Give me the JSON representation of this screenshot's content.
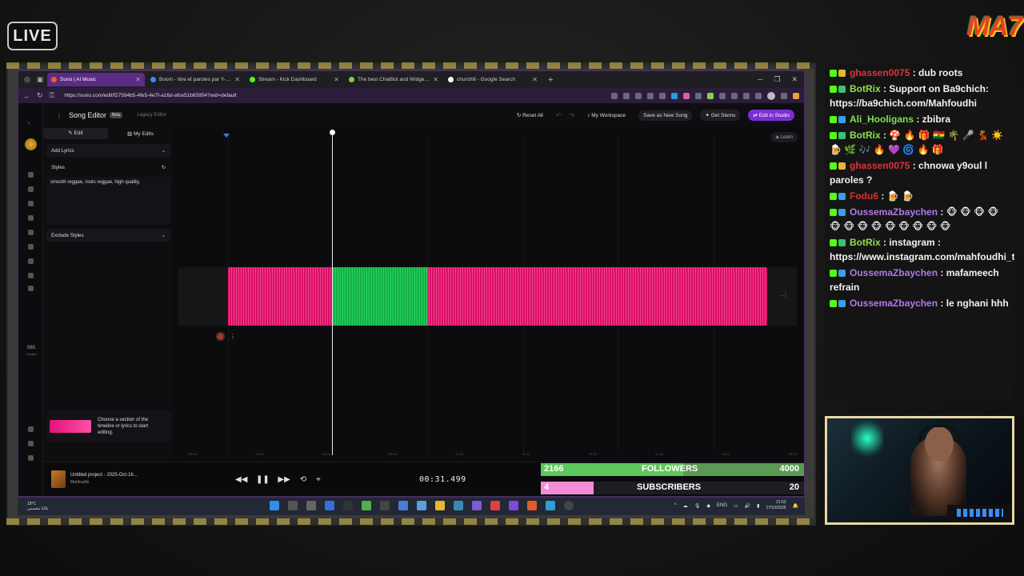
{
  "overlay": {
    "live_label": "LIVE",
    "logo_text": "MA7"
  },
  "browser": {
    "tabs": [
      {
        "label": "Suno | AI Music",
        "active": true
      },
      {
        "label": "Boom - titre et paroles par Y-Jey",
        "active": false
      },
      {
        "label": "Stream - Kick Dashboard",
        "active": false
      },
      {
        "label": "The best ChatBot and Widgets fo",
        "active": false
      },
      {
        "label": "churchill - Google Search",
        "active": false
      }
    ],
    "url": "https://suno.com/edit/f27594b5-4fe5-4e7f-a16d-afce51b65954?wid=default"
  },
  "app": {
    "title": "Song Editor",
    "beta_label": "Beta",
    "legacy_label": "Legacy Editor",
    "actions": {
      "reset_all": "Reset All",
      "workspace": "My Workspace",
      "save_new": "Save as New Song",
      "get_stems": "Get Stems",
      "edit_studio": "Edit in Studio"
    },
    "left_tabs": {
      "edit": "Edit",
      "my_edits": "My Edits"
    },
    "add_lyrics": "Add Lyrics",
    "styles_label": "Styles",
    "styles_value": "smooth reggae, roots reggae, high quality,",
    "exclude_styles": "Exclude Styles",
    "hint": "Choose a section of the timeline or lyrics to start editing.",
    "credits_value": "565",
    "credits_label": "Credits",
    "learn": "Learn",
    "ruler_ticks": [
      "00:00",
      "00:15",
      "00:30",
      "00:45",
      "01:00",
      "01:15",
      "01:30",
      "01:45",
      "02:00",
      "02:15"
    ],
    "song_title": "Untitled project - 2025-Oct-16...",
    "song_artist": "Mahfoudhi",
    "timecode": "00:31.499"
  },
  "goals": {
    "followers": {
      "current": "2166",
      "label": "FOLLOWERS",
      "target": "4000",
      "progress": 0.54
    },
    "subscribers": {
      "current": "4",
      "label": "SUBSCRIBERS",
      "target": "20",
      "progress": 0.2
    }
  },
  "taskbar": {
    "temp": "19°C",
    "weather_note": "غالبا مشمس",
    "lang": "ENG",
    "time": "21:53",
    "date": "17/10/2025"
  },
  "chat": [
    {
      "user": "ghassen0075",
      "color": "#e0323a",
      "text": ": dub roots"
    },
    {
      "user": "BotRix",
      "color": "#8fe14a",
      "text": ": Support on Ba9chich: https://ba9chich.com/Mahfoudhi"
    },
    {
      "user": "Ali_Hooligans",
      "color": "#7ee04e",
      "text": ": zbibra"
    },
    {
      "user": "BotRix",
      "color": "#8fe14a",
      "text": ": 🍄 🔥 🎁 🇬🇭 🌴 🎤 💃 ☀️ 🍺 🌿 🎶 🔥 💜 🌀 🔥 🎁"
    },
    {
      "user": "ghassen0075",
      "color": "#e0323a",
      "text": ": chnowa y9oul l paroles ?"
    },
    {
      "user": "Fodu6",
      "color": "#d2322d",
      "text": ": 🍺 🍺"
    },
    {
      "user": "OussemaZbaychen",
      "color": "#b07ae8",
      "text": ": 🐵 🐵 🐵 🐵 🐵 🐵 🐵 🐵 🐵 🐵 🐵 🐵 🐵"
    },
    {
      "user": "BotRix",
      "color": "#8fe14a",
      "text": ": instagram : https://www.instagram.com/mahfoudhi_tn/"
    },
    {
      "user": "OussemaZbaychen",
      "color": "#b07ae8",
      "text": ": mafameech refrain"
    },
    {
      "user": "OussemaZbaychen",
      "color": "#b07ae8",
      "text": ": le nghani hhh"
    }
  ]
}
